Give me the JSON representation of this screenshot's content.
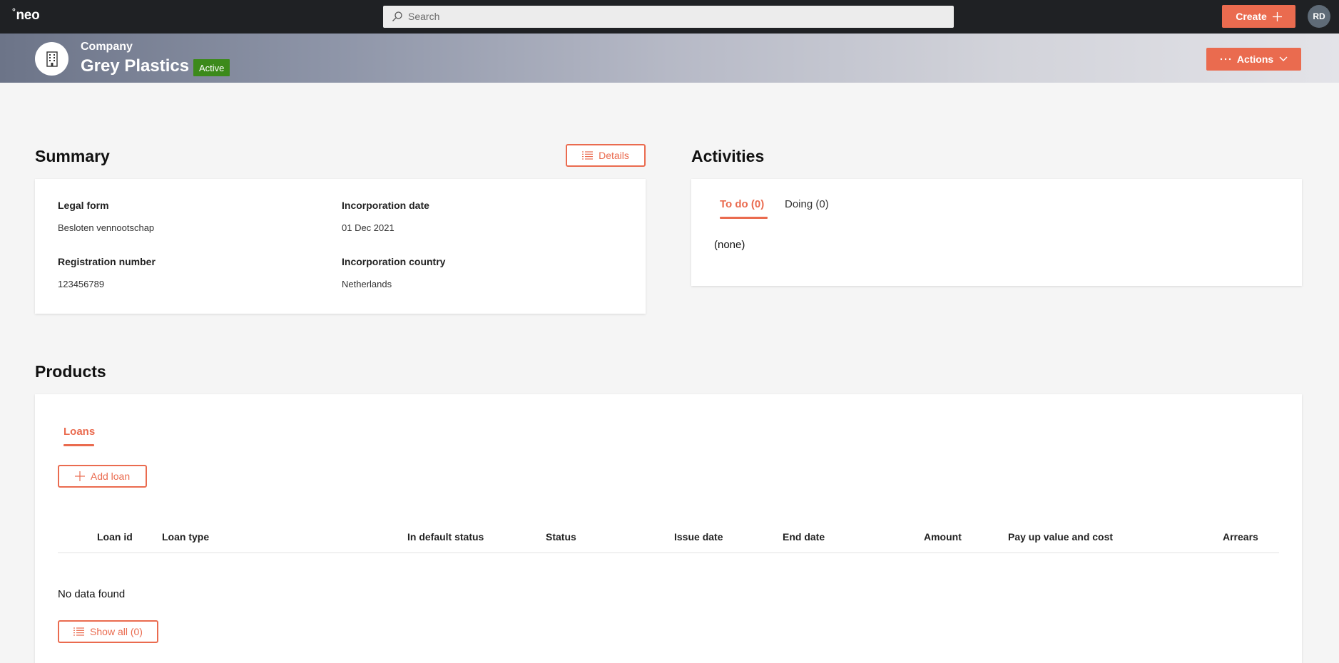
{
  "topbar": {
    "logo": "neo",
    "search_placeholder": "Search",
    "create_label": "Create",
    "avatar_initials": "RD"
  },
  "header": {
    "type": "Company",
    "name": "Grey Plastics",
    "status": "Active",
    "actions_label": "Actions"
  },
  "summary": {
    "title": "Summary",
    "details_label": "Details",
    "fields": [
      {
        "label": "Legal form",
        "value": "Besloten vennootschap"
      },
      {
        "label": "Incorporation date",
        "value": "01 Dec 2021"
      },
      {
        "label": "Registration number",
        "value": "123456789"
      },
      {
        "label": "Incorporation country",
        "value": "Netherlands"
      }
    ]
  },
  "activities": {
    "title": "Activities",
    "tabs": [
      {
        "label": "To do (0)"
      },
      {
        "label": "Doing (0)"
      }
    ],
    "empty_text": "(none)"
  },
  "products": {
    "title": "Products",
    "tabs": [
      {
        "label": "Loans"
      }
    ],
    "add_label": "Add loan",
    "columns": [
      "Loan id",
      "Loan type",
      "In default status",
      "Status",
      "Issue date",
      "End date",
      "Amount",
      "Pay up value and cost",
      "Arrears"
    ],
    "empty_text": "No data found",
    "show_all_label": "Show all (0)"
  },
  "colors": {
    "accent": "#ea6b4f",
    "topbar": "#1f2124",
    "status_active": "#3c8a1a"
  }
}
